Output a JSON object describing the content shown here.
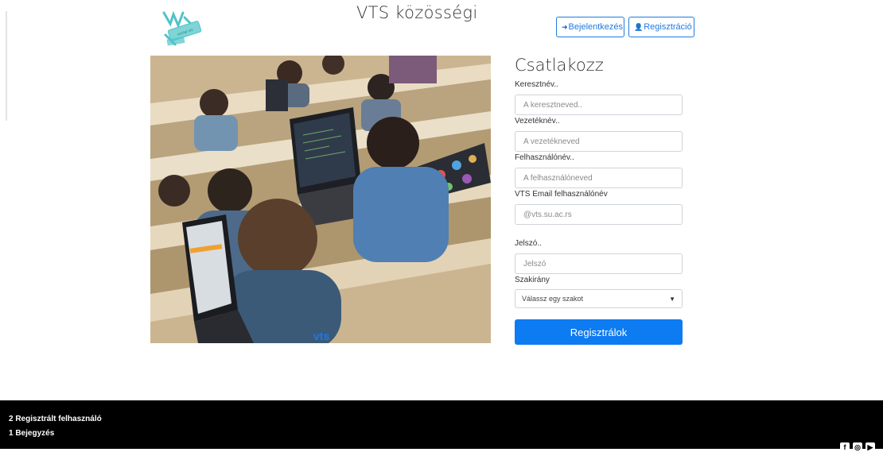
{
  "header": {
    "title": "VTS közösségi",
    "logo_text": "social vts",
    "login_label": "Bejelentkezés",
    "register_label": "Regisztráció"
  },
  "form": {
    "title": "Csatlakozz",
    "firstname_label": "Keresztnév..",
    "firstname_placeholder": "A keresztneved..",
    "lastname_label": "Vezetéknév..",
    "lastname_placeholder": "A vezetékneved",
    "username_label": "Felhasználónév..",
    "username_placeholder": "A felhasználóneved",
    "email_label": "VTS Email felhasználónév",
    "email_placeholder": "@vts.su.ac.rs",
    "password_label": "Jelszó..",
    "password_placeholder": "Jelszó",
    "major_label": "Szakirány",
    "major_selected": "Válassz egy szakot",
    "submit_label": "Regisztrálok"
  },
  "footer": {
    "registered_users": "2 Regisztrált felhasználó",
    "posts": "1 Bejegyzés",
    "social_icons": [
      "facebook-icon",
      "instagram-icon",
      "youtube-icon"
    ]
  },
  "colors": {
    "accent": "#1f7ae0",
    "submit_bg": "#0d7bf2",
    "footer_bg": "#000000",
    "logo_teal": "#4fc3c8"
  }
}
